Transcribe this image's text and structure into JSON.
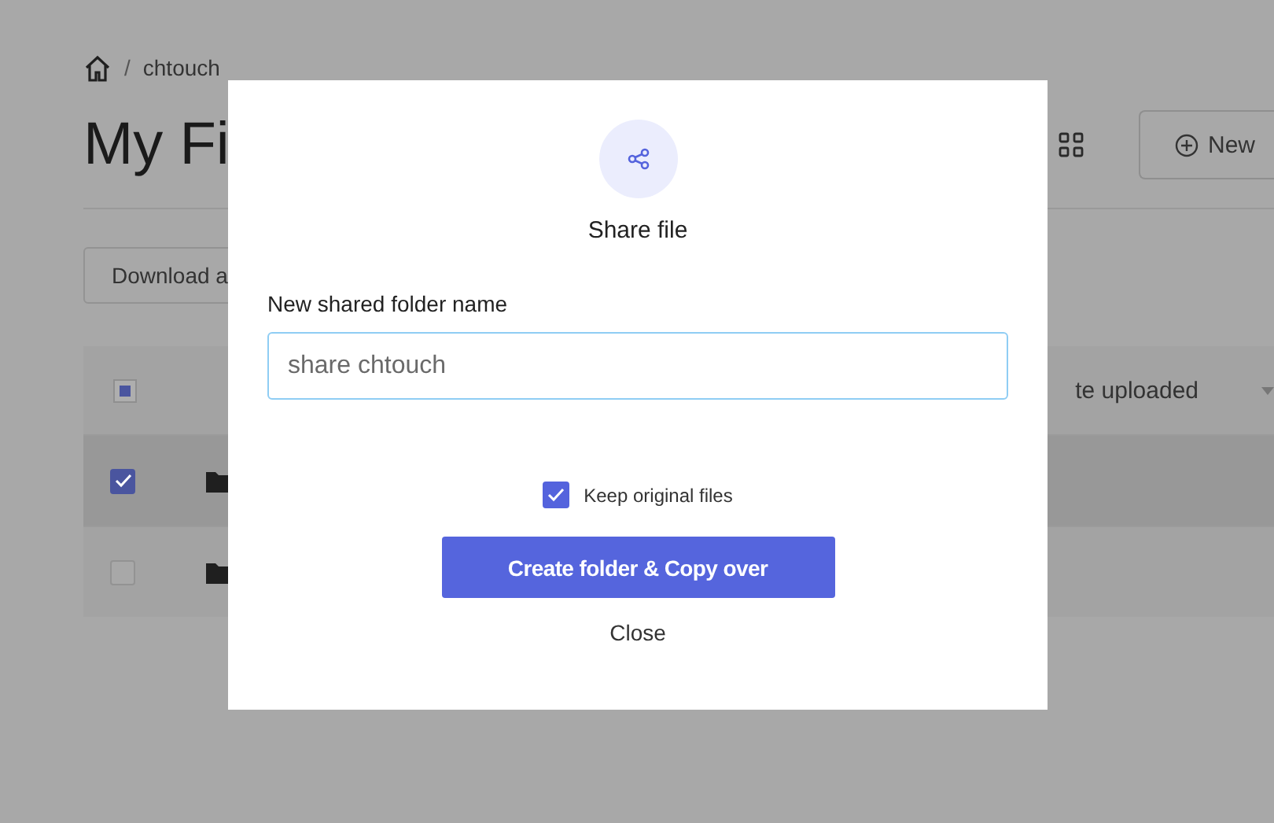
{
  "breadcrumb": {
    "separator": "/",
    "current": "chtouch"
  },
  "page": {
    "title": "My Fi",
    "new_button": "New",
    "download_button": "Download a"
  },
  "table": {
    "header": {
      "partially_checked": true,
      "date_column": "te uploaded"
    },
    "rows": [
      {
        "checked": true
      },
      {
        "checked": false
      }
    ]
  },
  "dialog": {
    "title": "Share file",
    "field_label": "New shared folder name",
    "field_value": "share chtouch",
    "keep_original": {
      "label": "Keep original files",
      "checked": true
    },
    "primary_button": "Create folder & Copy over",
    "close_button": "Close"
  }
}
